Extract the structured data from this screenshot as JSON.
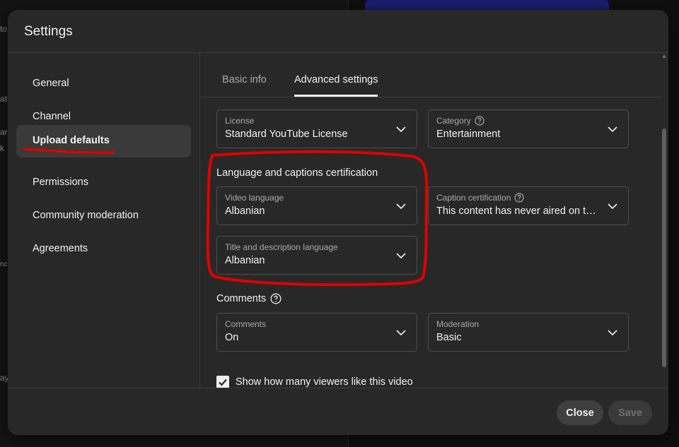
{
  "background": {
    "fragments": [
      "to",
      "ati",
      "ar",
      "k",
      "nc",
      "ay"
    ],
    "accent_color": "#1a1f6e"
  },
  "dialog": {
    "title": "Settings",
    "sidebar": {
      "items": [
        {
          "label": "General",
          "active": false
        },
        {
          "label": "Channel",
          "active": false
        },
        {
          "label": "Upload defaults",
          "active": true
        },
        {
          "label": "Permissions",
          "active": false
        },
        {
          "label": "Community moderation",
          "active": false
        },
        {
          "label": "Agreements",
          "active": false
        }
      ]
    },
    "tabs": [
      {
        "label": "Basic info",
        "active": false
      },
      {
        "label": "Advanced settings",
        "active": true
      }
    ],
    "fields": {
      "license": {
        "label": "License",
        "value": "Standard YouTube License"
      },
      "category": {
        "label": "Category",
        "value": "Entertainment",
        "icon": "help-icon"
      },
      "video_language": {
        "label": "Video language",
        "value": "Albanian"
      },
      "caption_certification": {
        "label": "Caption certification",
        "value": "This content has never aired on television in the U.S.",
        "icon": "help-icon"
      },
      "title_description_language": {
        "label": "Title and description language",
        "value": "Albanian"
      },
      "comments": {
        "label": "Comments",
        "value": "On"
      },
      "moderation": {
        "label": "Moderation",
        "value": "Basic"
      }
    },
    "sections": {
      "language": "Language and captions certification",
      "comments": "Comments"
    },
    "checkbox": {
      "label": "Show how many viewers like this video",
      "checked": true
    },
    "footer": {
      "close_label": "Close",
      "save_label": "Save"
    }
  },
  "annotation": {
    "color": "#e00000"
  }
}
